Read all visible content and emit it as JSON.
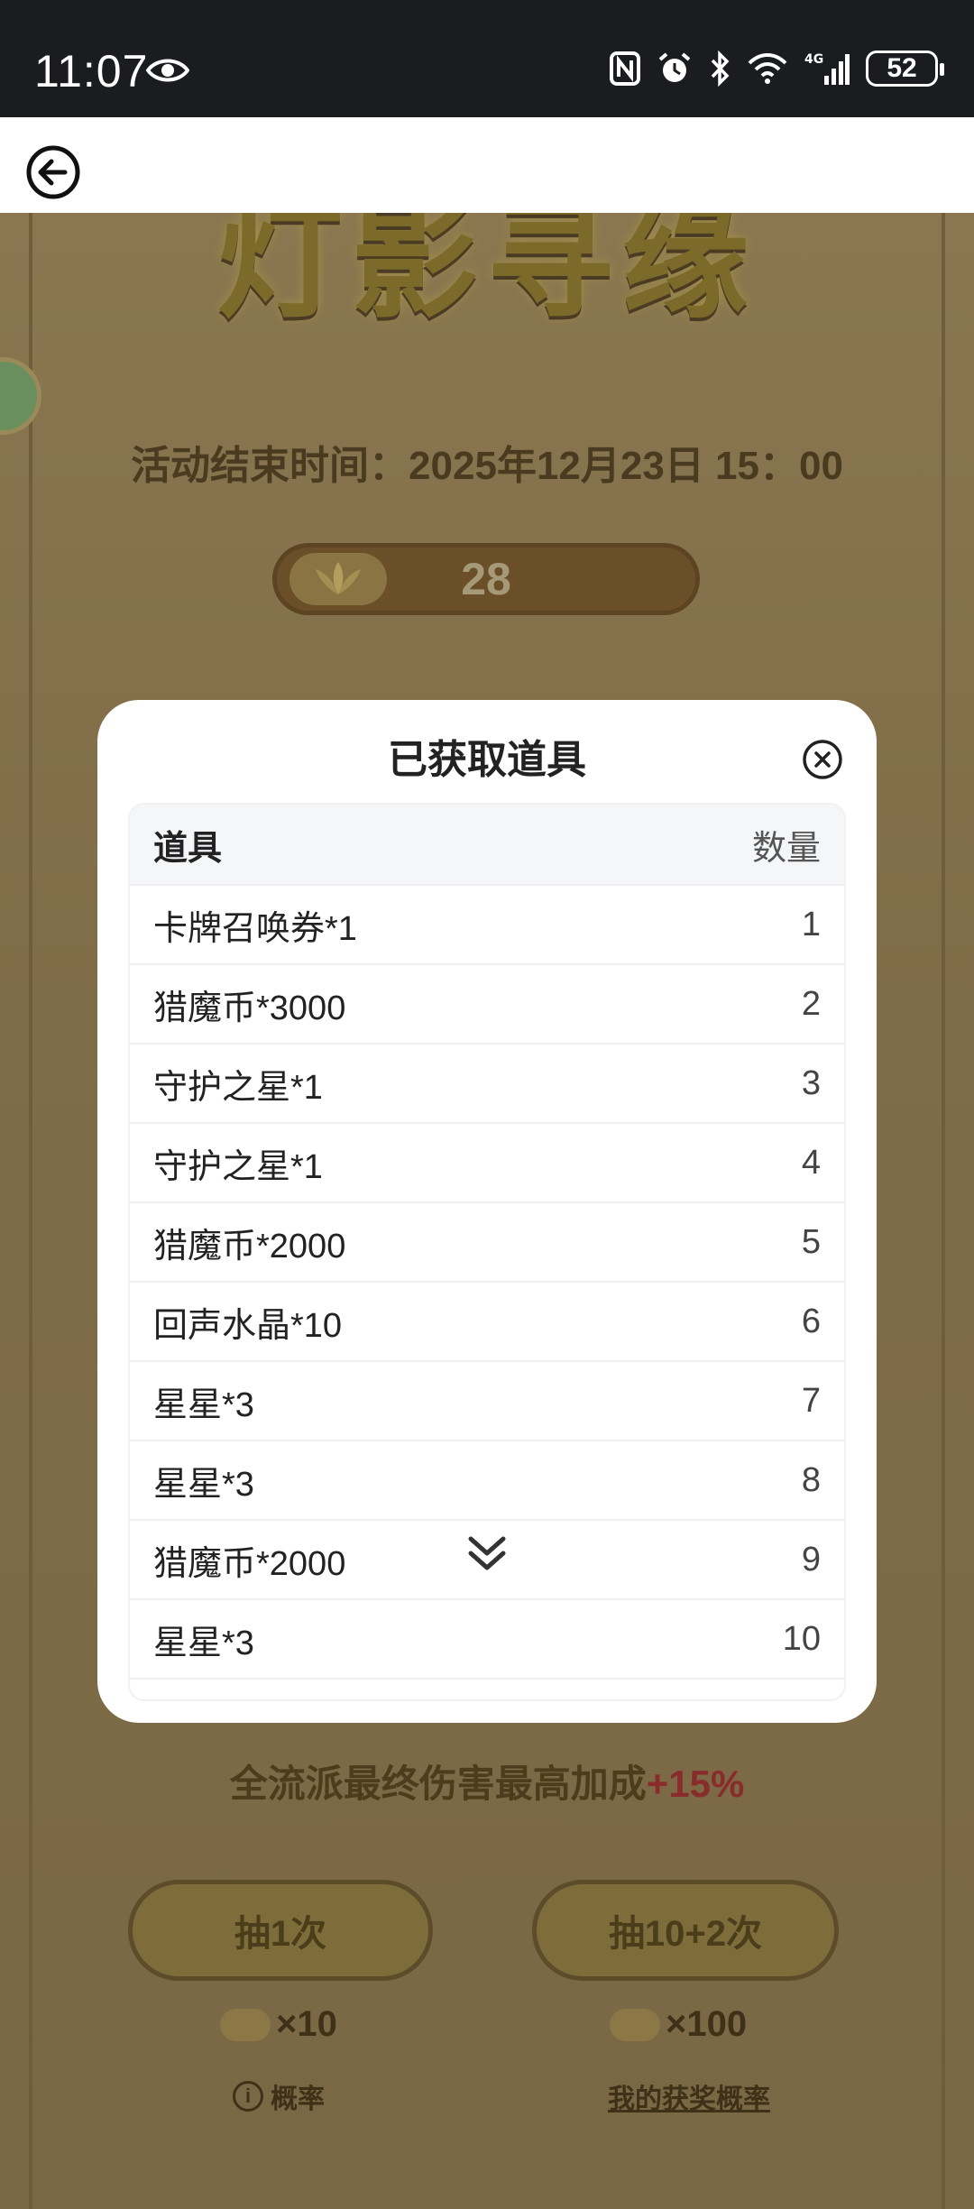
{
  "status_bar": {
    "time": "11:07",
    "battery": "52"
  },
  "game": {
    "title": "灯影寻缘",
    "end_time": "活动结束时间：2025年12月23日 15：00",
    "lotus_count": "28",
    "buff_text": "全流派最终伤害最高加成",
    "buff_pct": "+15%",
    "draw_once": "抽1次",
    "draw_ten": "抽10+2次",
    "cost_once": "×10",
    "cost_ten": "×100",
    "prob_label": "概率",
    "my_prob_label": "我的获奖概率"
  },
  "modal": {
    "title": "已获取道具",
    "header_item": "道具",
    "header_qty": "数量",
    "rows": [
      {
        "name": "卡牌召唤券*1",
        "qty": "1"
      },
      {
        "name": "猎魔币*3000",
        "qty": "2"
      },
      {
        "name": "守护之星*1",
        "qty": "3"
      },
      {
        "name": "守护之星*1",
        "qty": "4"
      },
      {
        "name": "猎魔币*2000",
        "qty": "5"
      },
      {
        "name": "回声水晶*10",
        "qty": "6"
      },
      {
        "name": "星星*3",
        "qty": "7"
      },
      {
        "name": "星星*3",
        "qty": "8"
      },
      {
        "name": "猎魔币*2000",
        "qty": "9"
      },
      {
        "name": "星星*3",
        "qty": "10"
      }
    ]
  }
}
